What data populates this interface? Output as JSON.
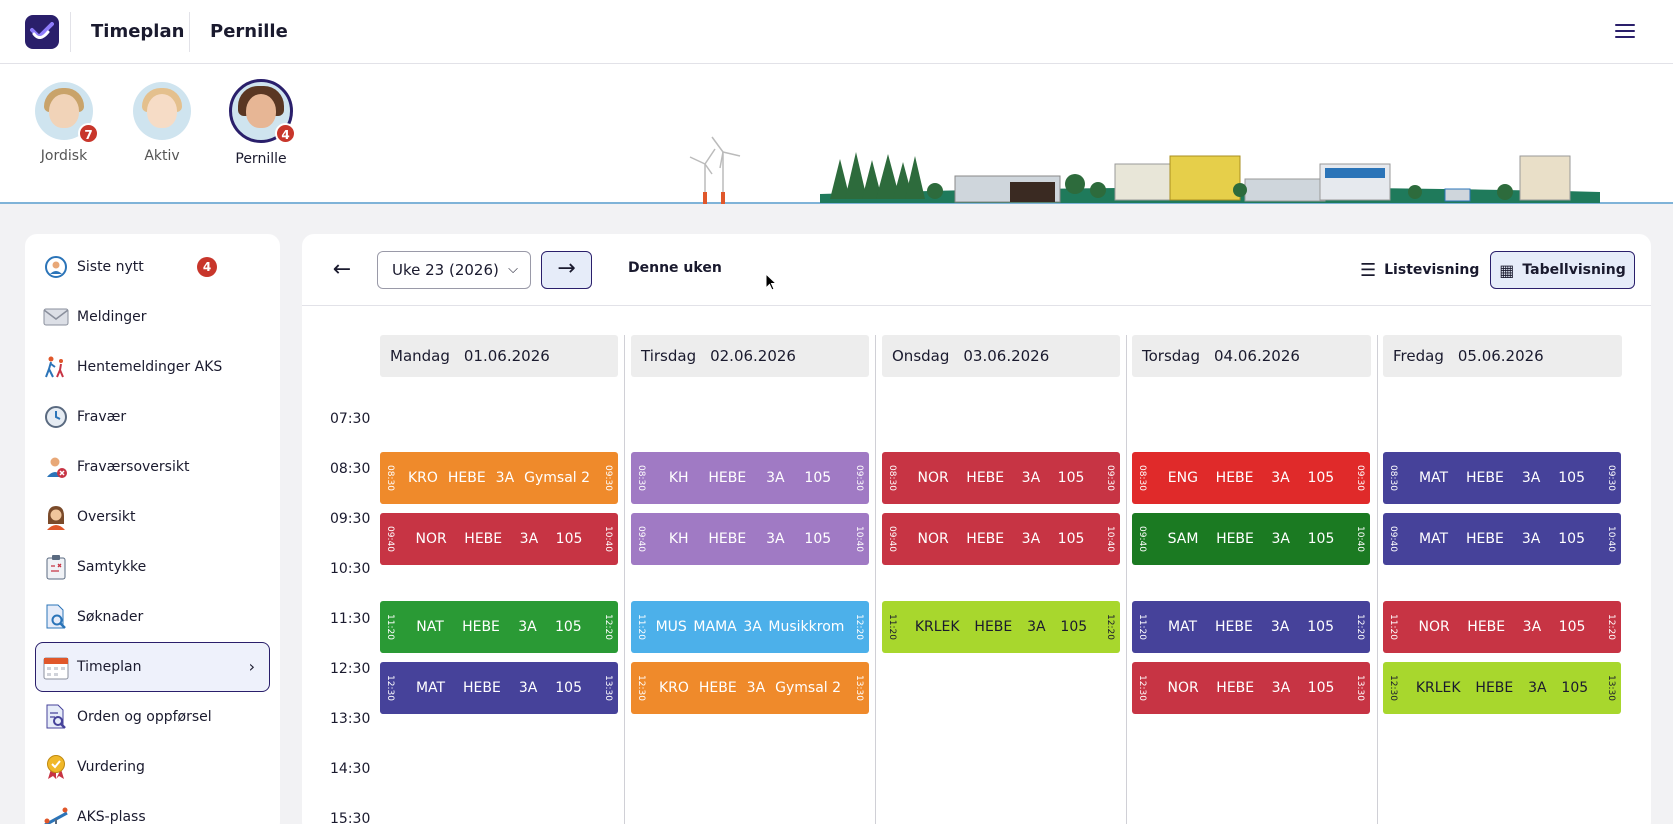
{
  "header": {
    "app_title": "Timeplan",
    "selected_child": "Pernille",
    "menu_icon": "hamburger-menu-icon"
  },
  "children": [
    {
      "name": "Jordisk",
      "badge": "7",
      "active": false
    },
    {
      "name": "Aktiv",
      "badge": "",
      "active": false
    },
    {
      "name": "Pernille",
      "badge": "4",
      "active": true
    }
  ],
  "sidebar": {
    "items": [
      {
        "label": "Siste nytt",
        "icon": "refresh-person-icon",
        "badge": "4"
      },
      {
        "label": "Meldinger",
        "icon": "envelope-icon",
        "badge": ""
      },
      {
        "label": "Hentemeldinger AKS",
        "icon": "walking-people-icon",
        "badge": ""
      },
      {
        "label": "Fravær",
        "icon": "clock-icon",
        "badge": ""
      },
      {
        "label": "Fraværsoversikt",
        "icon": "person-absence-icon",
        "badge": ""
      },
      {
        "label": "Oversikt",
        "icon": "person-overview-icon",
        "badge": ""
      },
      {
        "label": "Samtykke",
        "icon": "clipboard-icon",
        "badge": ""
      },
      {
        "label": "Søknader",
        "icon": "document-search-icon",
        "badge": ""
      },
      {
        "label": "Timeplan",
        "icon": "calendar-icon",
        "badge": "",
        "active": true
      },
      {
        "label": "Orden og oppførsel",
        "icon": "document-magnifier-icon",
        "badge": ""
      },
      {
        "label": "Vurdering",
        "icon": "medal-icon",
        "badge": ""
      },
      {
        "label": "AKS-plass",
        "icon": "playground-icon",
        "badge": ""
      }
    ]
  },
  "toolbar": {
    "week_value": "Uke 23 (2026)",
    "this_week_label": "Denne uken",
    "list_view_label": "Listevisning",
    "table_view_label": "Tabellvisning"
  },
  "days": [
    {
      "name": "Mandag",
      "date": "01.06.2026"
    },
    {
      "name": "Tirsdag",
      "date": "02.06.2026"
    },
    {
      "name": "Onsdag",
      "date": "03.06.2026"
    },
    {
      "name": "Torsdag",
      "date": "04.06.2026"
    },
    {
      "name": "Fredag",
      "date": "05.06.2026"
    }
  ],
  "times": [
    "07:30",
    "08:30",
    "09:30",
    "10:30",
    "11:30",
    "12:30",
    "13:30",
    "14:30",
    "15:30"
  ],
  "colors": {
    "orange": "#ef8a2b",
    "purple": "#a07ac4",
    "red": "#c73444",
    "bright_red": "#e02a2a",
    "indigo": "#46429a",
    "green": "#2a9a35",
    "dark_green": "#1b7a22",
    "blue": "#4cb0ea",
    "lime": "#a8d72d"
  },
  "lessons": [
    {
      "day": 0,
      "slot": 0,
      "start": "08:30",
      "end": "09:30",
      "subject": "KRO",
      "teacher": "HEBE",
      "group": "3A",
      "room": "Gymsal 2",
      "color": "#ef8a2b"
    },
    {
      "day": 0,
      "slot": 1,
      "start": "09:40",
      "end": "10:40",
      "subject": "NOR",
      "teacher": "HEBE",
      "group": "3A",
      "room": "105",
      "color": "#c73444"
    },
    {
      "day": 0,
      "slot": 2,
      "start": "11:20",
      "end": "12:20",
      "subject": "NAT",
      "teacher": "HEBE",
      "group": "3A",
      "room": "105",
      "color": "#2a9a35"
    },
    {
      "day": 0,
      "slot": 3,
      "start": "12:30",
      "end": "13:30",
      "subject": "MAT",
      "teacher": "HEBE",
      "group": "3A",
      "room": "105",
      "color": "#46429a"
    },
    {
      "day": 1,
      "slot": 0,
      "start": "08:30",
      "end": "09:30",
      "subject": "KH",
      "teacher": "HEBE",
      "group": "3A",
      "room": "105",
      "color": "#a07ac4"
    },
    {
      "day": 1,
      "slot": 1,
      "start": "09:40",
      "end": "10:40",
      "subject": "KH",
      "teacher": "HEBE",
      "group": "3A",
      "room": "105",
      "color": "#a07ac4"
    },
    {
      "day": 1,
      "slot": 2,
      "start": "11:20",
      "end": "12:20",
      "subject": "MUS",
      "teacher": "MAMA",
      "group": "3A",
      "room": "Musikkrom",
      "color": "#4cb0ea"
    },
    {
      "day": 1,
      "slot": 3,
      "start": "12:30",
      "end": "13:30",
      "subject": "KRO",
      "teacher": "HEBE",
      "group": "3A",
      "room": "Gymsal 2",
      "color": "#ef8a2b"
    },
    {
      "day": 2,
      "slot": 0,
      "start": "08:30",
      "end": "09:30",
      "subject": "NOR",
      "teacher": "HEBE",
      "group": "3A",
      "room": "105",
      "color": "#c73444"
    },
    {
      "day": 2,
      "slot": 1,
      "start": "09:40",
      "end": "10:40",
      "subject": "NOR",
      "teacher": "HEBE",
      "group": "3A",
      "room": "105",
      "color": "#c73444"
    },
    {
      "day": 2,
      "slot": 2,
      "start": "11:20",
      "end": "12:20",
      "subject": "KRLEK",
      "teacher": "HEBE",
      "group": "3A",
      "room": "105",
      "color": "#a8d72d"
    },
    {
      "day": 3,
      "slot": 0,
      "start": "08:30",
      "end": "09:30",
      "subject": "ENG",
      "teacher": "HEBE",
      "group": "3A",
      "room": "105",
      "color": "#e02a2a"
    },
    {
      "day": 3,
      "slot": 1,
      "start": "09:40",
      "end": "10:40",
      "subject": "SAM",
      "teacher": "HEBE",
      "group": "3A",
      "room": "105",
      "color": "#1b7a22"
    },
    {
      "day": 3,
      "slot": 2,
      "start": "11:20",
      "end": "12:20",
      "subject": "MAT",
      "teacher": "HEBE",
      "group": "3A",
      "room": "105",
      "color": "#46429a"
    },
    {
      "day": 3,
      "slot": 3,
      "start": "12:30",
      "end": "13:30",
      "subject": "NOR",
      "teacher": "HEBE",
      "group": "3A",
      "room": "105",
      "color": "#c73444"
    },
    {
      "day": 4,
      "slot": 0,
      "start": "08:30",
      "end": "09:30",
      "subject": "MAT",
      "teacher": "HEBE",
      "group": "3A",
      "room": "105",
      "color": "#46429a"
    },
    {
      "day": 4,
      "slot": 1,
      "start": "09:40",
      "end": "10:40",
      "subject": "MAT",
      "teacher": "HEBE",
      "group": "3A",
      "room": "105",
      "color": "#46429a"
    },
    {
      "day": 4,
      "slot": 2,
      "start": "11:20",
      "end": "12:20",
      "subject": "NOR",
      "teacher": "HEBE",
      "group": "3A",
      "room": "105",
      "color": "#c73444"
    },
    {
      "day": 4,
      "slot": 3,
      "start": "12:30",
      "end": "13:30",
      "subject": "KRLEK",
      "teacher": "HEBE",
      "group": "3A",
      "room": "105",
      "color": "#a8d72d"
    }
  ]
}
